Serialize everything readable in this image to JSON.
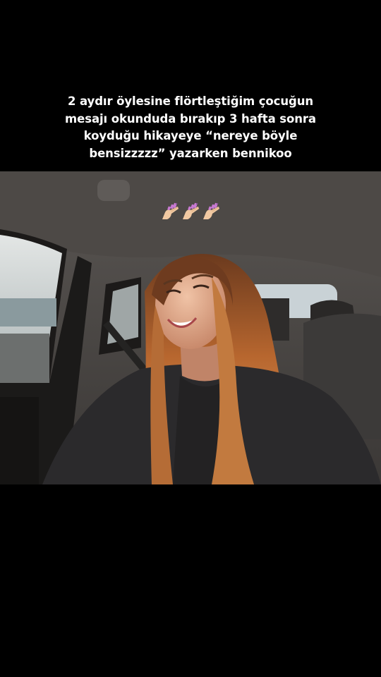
{
  "caption": {
    "lines": [
      "2 aydır öylesine flörtleştiğim çocuğun",
      "mesajı okunduda bırakıp 3 hafta sonra",
      "koyduğu hikayeye “nereye böyle",
      "bensizzzzz” yazarken bennikoo"
    ]
  },
  "photo": {
    "subject": "selfie-in-car",
    "colors": {
      "hair": "#b86a36",
      "hoodie": "#2b2a2c",
      "headliner": "#4a4643",
      "window": "#c9d2d6"
    }
  },
  "sticker": {
    "icon": "nail-polish-icon",
    "count": 3,
    "nail_color": "#c77ad1"
  }
}
